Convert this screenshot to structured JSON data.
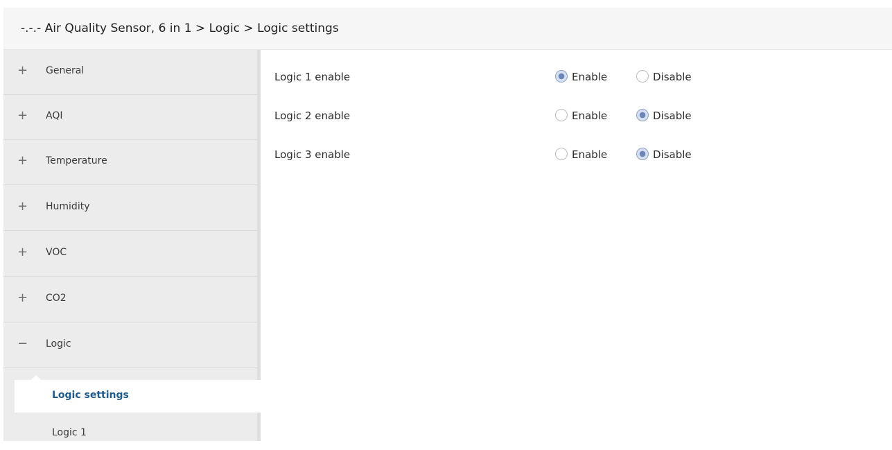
{
  "header": {
    "title": "-.-.- Air Quality Sensor, 6 in 1 > Logic > Logic settings"
  },
  "sidebar": {
    "items": [
      {
        "sign": "+",
        "label": "General"
      },
      {
        "sign": "+",
        "label": "AQI"
      },
      {
        "sign": "+",
        "label": "Temperature"
      },
      {
        "sign": "+",
        "label": "Humidity"
      },
      {
        "sign": "+",
        "label": "VOC"
      },
      {
        "sign": "+",
        "label": "CO2"
      },
      {
        "sign": "−",
        "label": "Logic"
      }
    ],
    "subitems": [
      {
        "label": "Logic settings",
        "active": true
      },
      {
        "label": "Logic 1",
        "active": false
      }
    ]
  },
  "settings": [
    {
      "label": "Logic 1 enable",
      "options": [
        "Enable",
        "Disable"
      ],
      "selected": "Enable"
    },
    {
      "label": "Logic 2 enable",
      "options": [
        "Enable",
        "Disable"
      ],
      "selected": "Disable"
    },
    {
      "label": "Logic 3 enable",
      "options": [
        "Enable",
        "Disable"
      ],
      "selected": "Disable"
    }
  ]
}
